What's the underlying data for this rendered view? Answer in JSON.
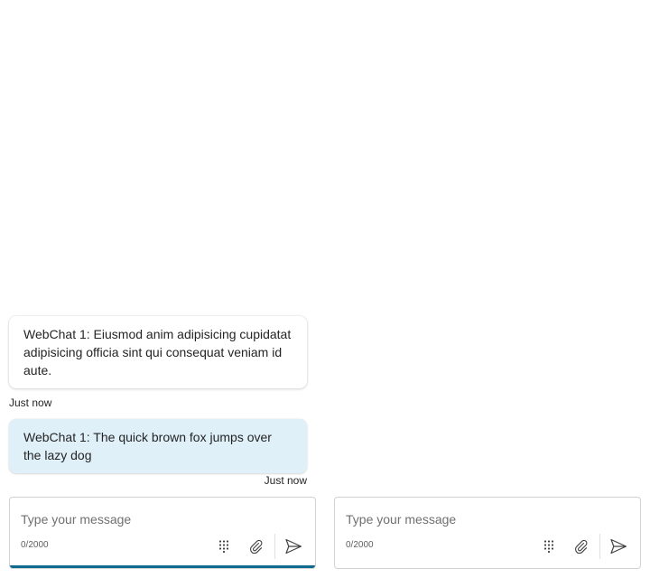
{
  "webchats": [
    {
      "messages": [
        {
          "direction": "incoming",
          "text": "WebChat 1: Eiusmod anim adipisicing cupidatat adipisicing officia sint qui consequat veniam id aute.",
          "timestamp": "Just now"
        },
        {
          "direction": "outgoing",
          "text": "WebChat 1: The quick brown fox jumps over the lazy dog",
          "timestamp": "Just now"
        }
      ],
      "composer": {
        "placeholder": "Type your message",
        "value": "",
        "char_count": "0/2000",
        "focused": true
      }
    },
    {
      "messages": [],
      "composer": {
        "placeholder": "Type your message",
        "value": "",
        "char_count": "0/2000",
        "focused": false
      }
    }
  ],
  "icons": {
    "keypad": "keypad-icon",
    "attach": "paperclip-icon",
    "send": "send-icon"
  },
  "colors": {
    "outgoing_bubble": "#dff0f9",
    "focus_accent": "#0f6a8f"
  }
}
